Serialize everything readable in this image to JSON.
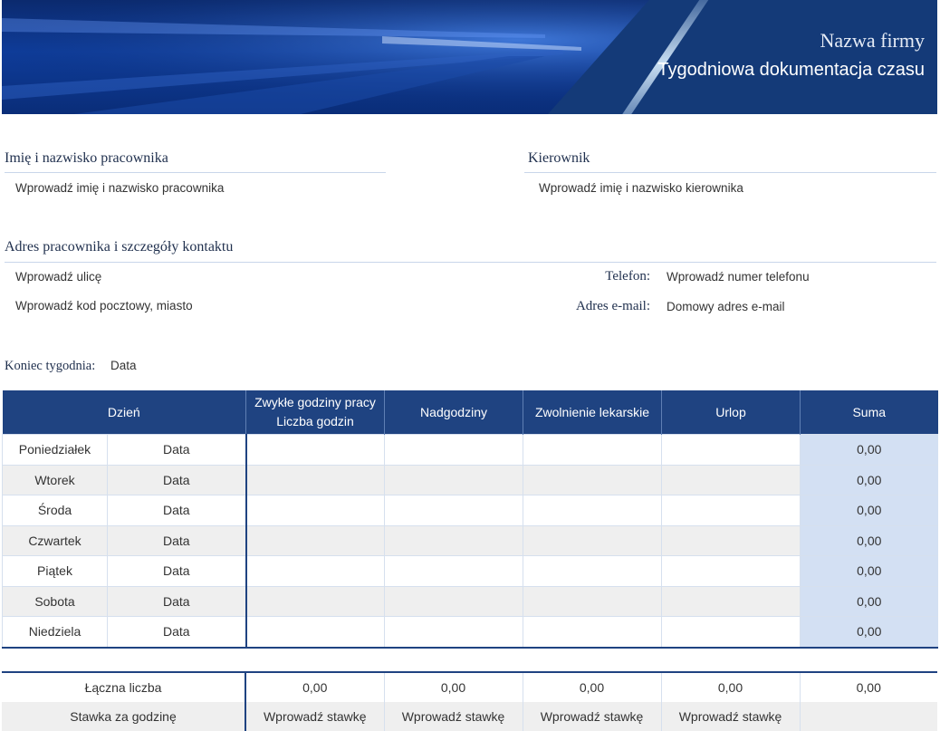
{
  "header": {
    "company_name": "Nazwa firmy",
    "title": "Tygodniowa dokumentacja czasu"
  },
  "employee": {
    "label": "Imię i nazwisko pracownika",
    "placeholder": "Wprowadź imię i nazwisko pracownika"
  },
  "manager": {
    "label": "Kierownik",
    "placeholder": "Wprowadź imię i nazwisko kierownika"
  },
  "address": {
    "label": "Adres pracownika i szczegóły kontaktu",
    "street": "Wprowadź ulicę",
    "postal_city": "Wprowadź kod pocztowy, miasto",
    "phone_label": "Telefon:",
    "phone_value": "Wprowadź numer telefonu",
    "email_label": "Adres e-mail:",
    "email_value": "Domowy adres e-mail"
  },
  "week_end": {
    "label": "Koniec tygodnia:",
    "value": "Data"
  },
  "table": {
    "headers": {
      "day": "Dzień",
      "regular_line1": "Zwykłe godziny pracy",
      "regular_line2": "Liczba godzin",
      "overtime": "Nadgodziny",
      "sick": "Zwolnienie lekarskie",
      "vacation": "Urlop",
      "total": "Suma"
    },
    "rows": [
      {
        "day": "Poniedziałek",
        "date": "Data",
        "regular": "",
        "overtime": "",
        "sick": "",
        "vacation": "",
        "total": "0,00"
      },
      {
        "day": "Wtorek",
        "date": "Data",
        "regular": "",
        "overtime": "",
        "sick": "",
        "vacation": "",
        "total": "0,00"
      },
      {
        "day": "Środa",
        "date": "Data",
        "regular": "",
        "overtime": "",
        "sick": "",
        "vacation": "",
        "total": "0,00"
      },
      {
        "day": "Czwartek",
        "date": "Data",
        "regular": "",
        "overtime": "",
        "sick": "",
        "vacation": "",
        "total": "0,00"
      },
      {
        "day": "Piątek",
        "date": "Data",
        "regular": "",
        "overtime": "",
        "sick": "",
        "vacation": "",
        "total": "0,00"
      },
      {
        "day": "Sobota",
        "date": "Data",
        "regular": "",
        "overtime": "",
        "sick": "",
        "vacation": "",
        "total": "0,00"
      },
      {
        "day": "Niedziela",
        "date": "Data",
        "regular": "",
        "overtime": "",
        "sick": "",
        "vacation": "",
        "total": "0,00"
      }
    ]
  },
  "totals": {
    "total_label": "Łączna liczba",
    "total_values": [
      "0,00",
      "0,00",
      "0,00",
      "0,00",
      "0,00"
    ],
    "rate_label": "Stawka za godzinę",
    "rate_values": [
      "Wprowadź stawkę",
      "Wprowadź stawkę",
      "Wprowadź stawkę",
      "Wprowadź stawkę",
      ""
    ]
  },
  "colors": {
    "header_blue": "#1f4381",
    "total_column_fill": "#d3e0f3",
    "alt_row_fill": "#efefef"
  }
}
